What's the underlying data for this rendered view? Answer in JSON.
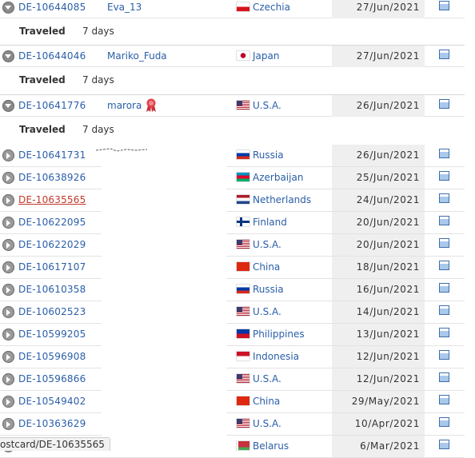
{
  "expanded_cards": [
    {
      "id": "DE-10644085",
      "user": "Eva_13",
      "country": "Czechia",
      "flag": "cz",
      "date": "27/Jun/2021",
      "traveled_label": "Traveled",
      "traveled_value": "7 days"
    },
    {
      "id": "DE-10644046",
      "user": "Mariko_Fuda",
      "country": "Japan",
      "flag": "jp",
      "date": "27/Jun/2021",
      "traveled_label": "Traveled",
      "traveled_value": "7 days"
    },
    {
      "id": "DE-10641776",
      "user": "marora",
      "country": "U.S.A.",
      "flag": "us",
      "date": "26/Jun/2021",
      "traveled_label": "Traveled",
      "traveled_value": "7 days",
      "badge": "ribbon-badge-icon"
    }
  ],
  "cards": [
    {
      "id": "DE-10641731",
      "country": "Russia",
      "flag": "ru",
      "date": "26/Jun/2021"
    },
    {
      "id": "DE-10638926",
      "country": "Azerbaijan",
      "flag": "az",
      "date": "25/Jun/2021"
    },
    {
      "id": "DE-10635565",
      "country": "Netherlands",
      "flag": "nl",
      "date": "24/Jun/2021",
      "visited": true
    },
    {
      "id": "DE-10622095",
      "country": "Finland",
      "flag": "fi",
      "date": "20/Jun/2021"
    },
    {
      "id": "DE-10622029",
      "country": "U.S.A.",
      "flag": "us",
      "date": "20/Jun/2021"
    },
    {
      "id": "DE-10617107",
      "country": "China",
      "flag": "cn",
      "date": "18/Jun/2021"
    },
    {
      "id": "DE-10610358",
      "country": "Russia",
      "flag": "ru",
      "date": "16/Jun/2021"
    },
    {
      "id": "DE-10602523",
      "country": "U.S.A.",
      "flag": "us",
      "date": "14/Jun/2021"
    },
    {
      "id": "DE-10599205",
      "country": "Philippines",
      "flag": "ph",
      "date": "13/Jun/2021"
    },
    {
      "id": "DE-10596908",
      "country": "Indonesia",
      "flag": "id",
      "date": "12/Jun/2021"
    },
    {
      "id": "DE-10596866",
      "country": "U.S.A.",
      "flag": "us",
      "date": "12/Jun/2021"
    },
    {
      "id": "DE-10549402",
      "country": "China",
      "flag": "cn",
      "date": "29/May/2021"
    },
    {
      "id": "DE-10363629",
      "country": "U.S.A.",
      "flag": "us",
      "date": "10/Apr/2021"
    },
    {
      "id": "",
      "country": "Belarus",
      "flag": "by",
      "date": "6/Mar/2021"
    }
  ],
  "status_bar": {
    "text": "ostcard/DE-10635565"
  },
  "colors": {
    "link": "#2a5ea8",
    "visited_link": "#c0392b",
    "date_bg": "#efefef"
  }
}
